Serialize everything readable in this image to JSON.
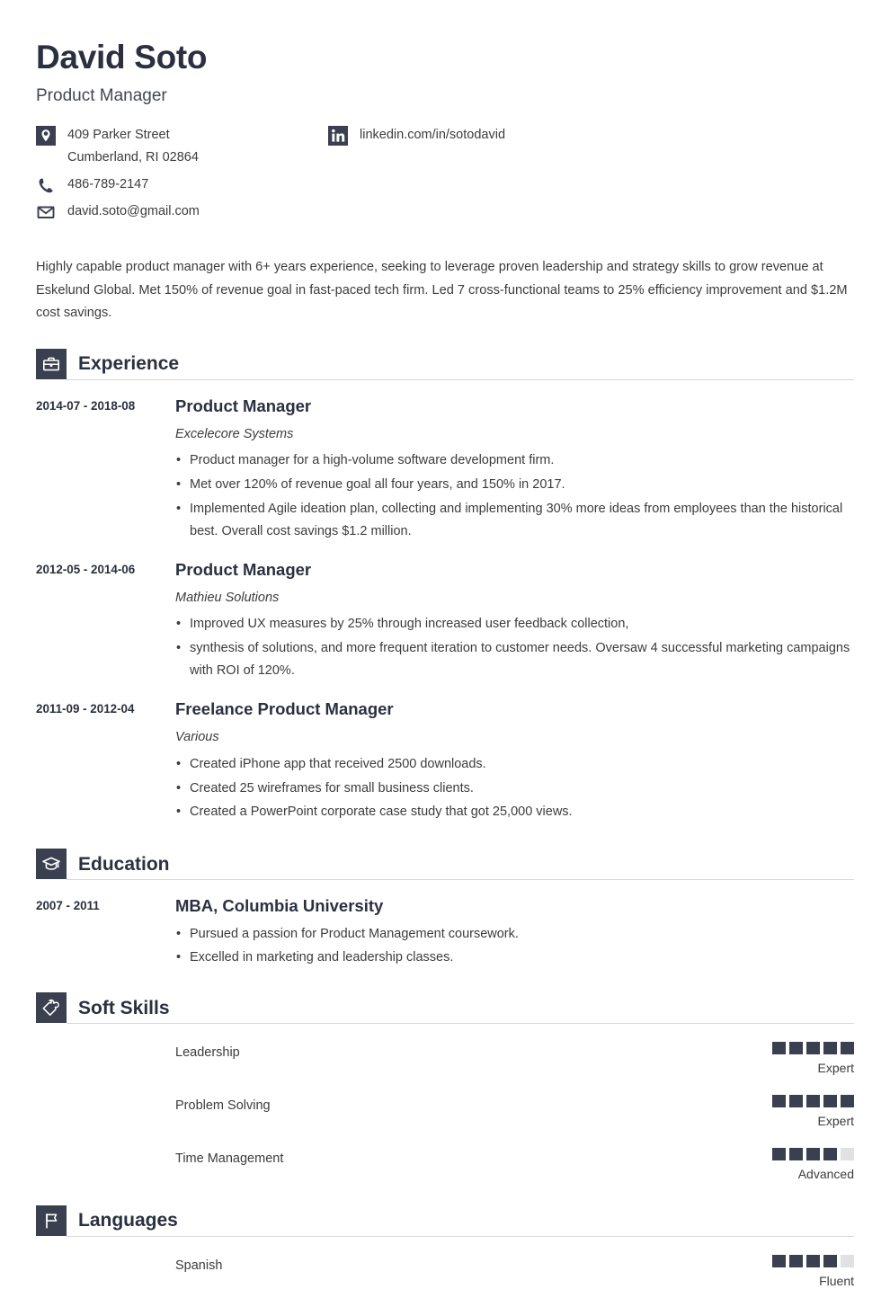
{
  "header": {
    "name": "David Soto",
    "job_title": "Product Manager"
  },
  "contact": {
    "address_line1": "409 Parker Street",
    "address_line2": "Cumberland, RI 02864",
    "phone": "486-789-2147",
    "email": "david.soto@gmail.com",
    "linkedin": "linkedin.com/in/sotodavid",
    "icons": {
      "address": "location-pin-icon",
      "phone": "phone-icon",
      "email": "envelope-icon",
      "linkedin": "linkedin-icon"
    }
  },
  "summary": "Highly capable product manager with 6+ years experience, seeking to leverage proven leadership and strategy skills to grow revenue at Eskelund Global. Met 150% of revenue goal in fast-paced tech firm. Led 7 cross-functional teams to 25% efficiency improvement and $1.2M cost savings.",
  "sections": {
    "experience": {
      "title": "Experience",
      "icon": "briefcase-icon",
      "entries": [
        {
          "date": "2014-07 - 2018-08",
          "role": "Product Manager",
          "org": "Excelecore Systems",
          "bullets": [
            "Product manager for a high-volume software development firm.",
            "Met over 120% of revenue goal all four years, and 150% in 2017.",
            "Implemented Agile ideation plan, collecting and implementing 30% more ideas from employees than the historical best. Overall cost savings $1.2 million."
          ]
        },
        {
          "date": "2012-05 - 2014-06",
          "role": "Product Manager",
          "org": "Mathieu Solutions",
          "bullets": [
            "Improved UX measures by 25% through increased user feedback collection,",
            "synthesis of solutions, and more frequent iteration to customer needs. Oversaw 4 successful marketing campaigns with ROI of 120%."
          ]
        },
        {
          "date": "2011-09 - 2012-04",
          "role": "Freelance Product Manager",
          "org": "Various",
          "bullets": [
            "Created iPhone app that received 2500 downloads.",
            "Created 25 wireframes for small business clients.",
            "Created a PowerPoint corporate case study that got 25,000 views."
          ]
        }
      ]
    },
    "education": {
      "title": "Education",
      "icon": "graduation-cap-icon",
      "entries": [
        {
          "date": "2007 - 2011",
          "degree": "MBA, Columbia University",
          "bullets": [
            "Pursued a passion for Product Management coursework.",
            "Excelled in marketing and leadership classes."
          ]
        }
      ]
    },
    "soft_skills": {
      "title": "Soft Skills",
      "icon": "puzzle-piece-icon",
      "max_rating": 5,
      "items": [
        {
          "name": "Leadership",
          "rating": 5,
          "level": "Expert"
        },
        {
          "name": "Problem Solving",
          "rating": 5,
          "level": "Expert"
        },
        {
          "name": "Time Management",
          "rating": 4,
          "level": "Advanced"
        }
      ]
    },
    "languages": {
      "title": "Languages",
      "icon": "flag-icon",
      "max_rating": 5,
      "items": [
        {
          "name": "Spanish",
          "rating": 4,
          "level": "Fluent"
        }
      ]
    }
  },
  "colors": {
    "accent_dark": "#3a4050",
    "heading": "#2b3040",
    "body_text": "#3c3c3c",
    "rule": "#d8d8d8",
    "dot_off": "#e0e1e3"
  }
}
